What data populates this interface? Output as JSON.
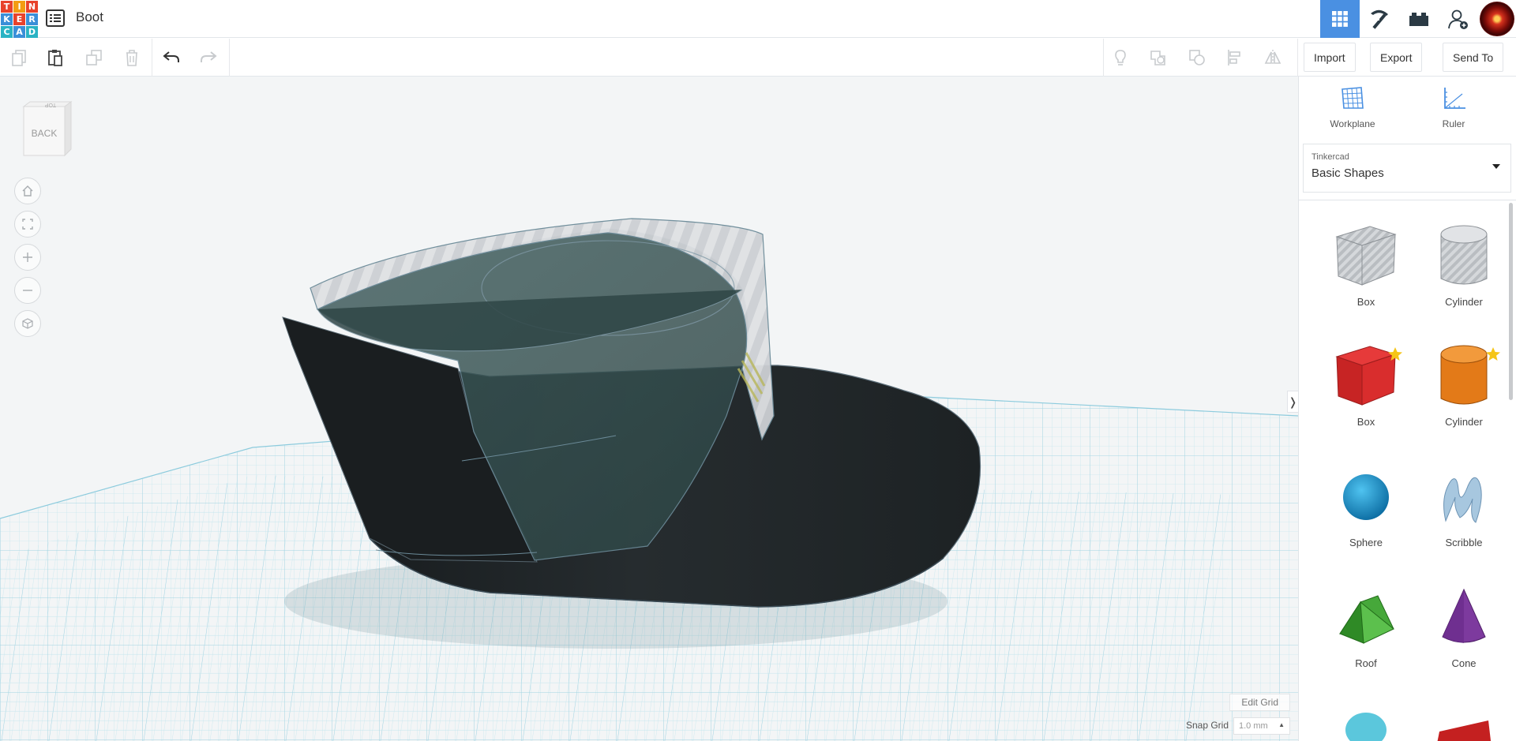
{
  "header": {
    "logo_letters": [
      "T",
      "I",
      "N",
      "K",
      "E",
      "R",
      "C",
      "A",
      "D"
    ],
    "logo_colors": [
      "#e8422b",
      "#f39c12",
      "#e8422b",
      "#3a8fd8",
      "#e8422b",
      "#3a8fd8",
      "#2ab3c4",
      "#3a8fd8",
      "#2ab3c4"
    ],
    "title": "Boot",
    "buttons": [
      "grid-view-icon",
      "pickaxe-icon",
      "brick-icon",
      "add-user-icon"
    ]
  },
  "toolbar": {
    "left_tools": [
      "copy-icon",
      "paste-icon",
      "duplicate-icon",
      "delete-icon",
      "undo-icon",
      "redo-icon"
    ],
    "right_tools": [
      "note-icon",
      "group-icon",
      "ungroup-icon",
      "align-icon",
      "mirror-icon"
    ],
    "import_label": "Import",
    "export_label": "Export",
    "send_to_label": "Send To"
  },
  "viewport": {
    "viewcube_top": "TOP",
    "viewcube_face": "BACK",
    "nav_buttons": [
      "home-icon",
      "fit-view-icon",
      "zoom-in-icon",
      "zoom-out-icon",
      "perspective-icon"
    ],
    "edit_grid_label": "Edit Grid",
    "snap_grid_label": "Snap Grid",
    "snap_grid_value": "1.0 mm"
  },
  "panel": {
    "workplane_label": "Workplane",
    "ruler_label": "Ruler",
    "library_category": "Tinkercad",
    "library_name": "Basic Shapes",
    "shapes": [
      {
        "label": "Box",
        "kind": "hole-box",
        "starred": false
      },
      {
        "label": "Cylinder",
        "kind": "hole-cylinder",
        "starred": false
      },
      {
        "label": "Box",
        "kind": "box",
        "starred": true
      },
      {
        "label": "Cylinder",
        "kind": "cylinder",
        "starred": true
      },
      {
        "label": "Sphere",
        "kind": "sphere",
        "starred": false
      },
      {
        "label": "Scribble",
        "kind": "scribble",
        "starred": false
      },
      {
        "label": "Roof",
        "kind": "roof",
        "starred": false
      },
      {
        "label": "Cone",
        "kind": "cone",
        "starred": false
      }
    ]
  },
  "colors": {
    "accent": "#4a90e2",
    "boot_dark": "#1f2528",
    "boot_glass": "#3a5a5a",
    "grid_line": "#b8e0ea"
  }
}
